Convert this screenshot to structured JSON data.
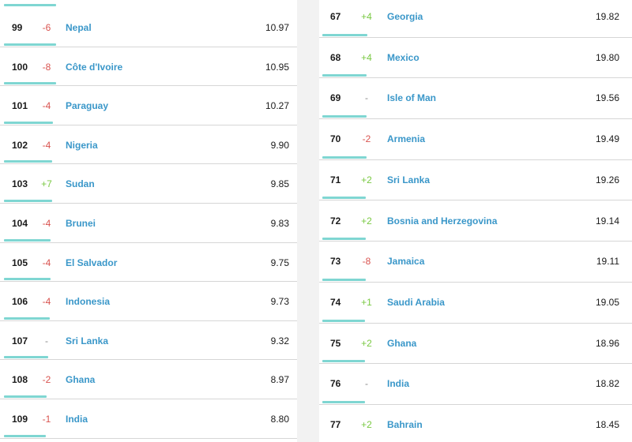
{
  "colors": {
    "up": "#7ac943",
    "down": "#d9534f",
    "same": "#8a8a8a",
    "country": "#3a97c9",
    "bar": "#7fd6d2"
  },
  "left_table": {
    "rows": [
      {
        "rank": "99",
        "change": "-6",
        "country": "Nepal",
        "score": "10.97",
        "bar_pct": 0.6
      },
      {
        "rank": "100",
        "change": "-8",
        "country": "Côte d'Ivoire",
        "score": "10.95",
        "bar_pct": 0.6
      },
      {
        "rank": "101",
        "change": "-4",
        "country": "Paraguay",
        "score": "10.27",
        "bar_pct": 0.56
      },
      {
        "rank": "102",
        "change": "-4",
        "country": "Nigeria",
        "score": "9.90",
        "bar_pct": 0.55
      },
      {
        "rank": "103",
        "change": "+7",
        "country": "Sudan",
        "score": "9.85",
        "bar_pct": 0.55
      },
      {
        "rank": "104",
        "change": "-4",
        "country": "Brunei",
        "score": "9.83",
        "bar_pct": 0.54
      },
      {
        "rank": "105",
        "change": "-4",
        "country": "El Salvador",
        "score": "9.75",
        "bar_pct": 0.54
      },
      {
        "rank": "106",
        "change": "-4",
        "country": "Indonesia",
        "score": "9.73",
        "bar_pct": 0.53
      },
      {
        "rank": "107",
        "change": "-",
        "country": "Sri Lanka",
        "score": "9.32",
        "bar_pct": 0.51
      },
      {
        "rank": "108",
        "change": "-2",
        "country": "Ghana",
        "score": "8.97",
        "bar_pct": 0.49
      },
      {
        "rank": "109",
        "change": "-1",
        "country": "India",
        "score": "8.80",
        "bar_pct": 0.48
      }
    ]
  },
  "right_table": {
    "rows": [
      {
        "rank": "67",
        "change": "+4",
        "country": "Georgia",
        "score": "19.82",
        "bar_pct": 0.52
      },
      {
        "rank": "68",
        "change": "+4",
        "country": "Mexico",
        "score": "19.80",
        "bar_pct": 0.51
      },
      {
        "rank": "69",
        "change": "-",
        "country": "Isle of Man",
        "score": "19.56",
        "bar_pct": 0.51
      },
      {
        "rank": "70",
        "change": "-2",
        "country": "Armenia",
        "score": "19.49",
        "bar_pct": 0.51
      },
      {
        "rank": "71",
        "change": "+2",
        "country": "Sri Lanka",
        "score": "19.26",
        "bar_pct": 0.5
      },
      {
        "rank": "72",
        "change": "+2",
        "country": "Bosnia and Herzegovina",
        "score": "19.14",
        "bar_pct": 0.5
      },
      {
        "rank": "73",
        "change": "-8",
        "country": "Jamaica",
        "score": "19.11",
        "bar_pct": 0.5
      },
      {
        "rank": "74",
        "change": "+1",
        "country": "Saudi Arabia",
        "score": "19.05",
        "bar_pct": 0.49
      },
      {
        "rank": "75",
        "change": "+2",
        "country": "Ghana",
        "score": "18.96",
        "bar_pct": 0.49
      },
      {
        "rank": "76",
        "change": "-",
        "country": "India",
        "score": "18.82",
        "bar_pct": 0.49
      },
      {
        "rank": "77",
        "change": "+2",
        "country": "Bahrain",
        "score": "18.45",
        "bar_pct": 0.48
      }
    ]
  }
}
